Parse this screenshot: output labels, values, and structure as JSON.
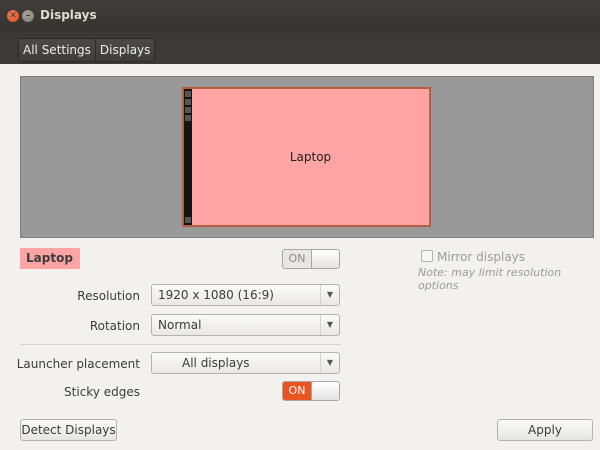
{
  "window": {
    "title": "Displays",
    "close_icon": "close-icon",
    "minimize_icon": "minimize-icon"
  },
  "breadcrumb": {
    "items": [
      {
        "label": "All Settings"
      },
      {
        "label": "Displays"
      }
    ]
  },
  "preview": {
    "monitor_label": "Laptop"
  },
  "display": {
    "name": "Laptop",
    "power_toggle": {
      "label": "ON",
      "state": "off"
    }
  },
  "mirror": {
    "label": "Mirror displays",
    "checked": false,
    "note": "Note: may limit resolution options"
  },
  "settings": {
    "resolution_label": "Resolution",
    "resolution_value": "1920 x 1080 (16:9)",
    "rotation_label": "Rotation",
    "rotation_value": "Normal",
    "launcher_label": "Launcher placement",
    "launcher_value": "All displays",
    "sticky_label": "Sticky edges",
    "sticky_toggle": {
      "label": "ON",
      "state": "on"
    }
  },
  "actions": {
    "detect_label": "Detect Displays",
    "apply_label": "Apply"
  },
  "colors": {
    "accent": "#e95420",
    "monitor_fill": "#ffa4a4"
  }
}
